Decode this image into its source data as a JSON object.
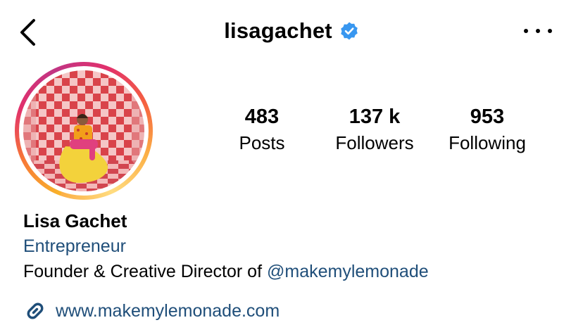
{
  "header": {
    "username": "lisagachet",
    "verified": true,
    "icons": {
      "back": "chevron-left-icon",
      "verified": "verified-badge-icon",
      "more": "more-horizontal-icon"
    }
  },
  "profile": {
    "avatar_alt": "profile-photo",
    "stats": [
      {
        "value": "483",
        "label": "Posts"
      },
      {
        "value": "137 k",
        "label": "Followers"
      },
      {
        "value": "953",
        "label": "Following"
      }
    ]
  },
  "bio": {
    "display_name": "Lisa Gachet",
    "category": "Entrepreneur",
    "description_prefix": "Founder & Creative Director of ",
    "mention": "@makemylemonade",
    "link": "www.makemylemonade.com",
    "link_icon": "link-icon"
  },
  "colors": {
    "link_blue": "#1f4e79",
    "verified_blue": "#3897f0",
    "checker_red": "#d9434a",
    "checker_pink": "#f5c6c6"
  }
}
